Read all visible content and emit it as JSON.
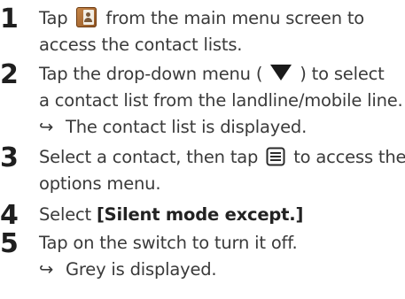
{
  "steps": [
    {
      "number": "1",
      "line1_pre": "Tap",
      "line1_post": "from the main menu screen to",
      "line2": "access the contact lists.",
      "icon": "contacts-book-icon"
    },
    {
      "number": "2",
      "line1_pre": "Tap the drop-down menu (",
      "line1_post": ") to select",
      "line2": "a contact list from the landline/mobile line.",
      "result": "The contact list is displayed.",
      "icon": "triangle-down-icon"
    },
    {
      "number": "3",
      "line1_pre": "Select a contact, then tap",
      "line1_post": "to access the",
      "line2": "options menu.",
      "icon": "options-menu-icon"
    },
    {
      "number": "4",
      "line1_pre": "Select",
      "bold": "[Silent mode except.]"
    },
    {
      "number": "5",
      "line1": "Tap on the switch to turn it off.",
      "result": "Grey is displayed."
    }
  ],
  "result_arrow": "↪",
  "colors": {
    "text": "#3a3a3a",
    "number": "#1f1f1f",
    "icon_brown": "#a86b33"
  }
}
